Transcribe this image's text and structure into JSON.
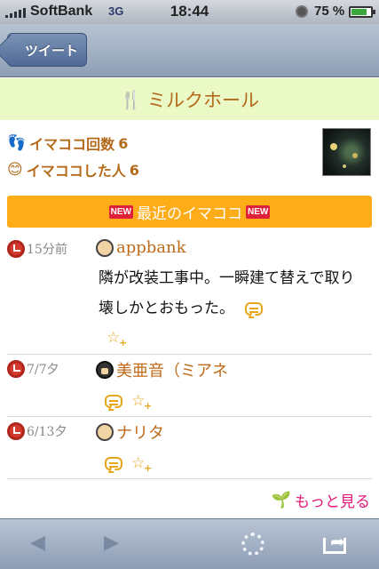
{
  "status": {
    "carrier": "SoftBank",
    "network": "3G",
    "time": "18:44",
    "battery_pct": "75 %",
    "battery_level": 0.75
  },
  "nav": {
    "back_label": "ツイート"
  },
  "title": {
    "text": "ミルクホール"
  },
  "stats": {
    "checkins_label": "イマココ回数",
    "checkins_value": "6",
    "people_label": "イマココした人",
    "people_value": "6"
  },
  "section": {
    "badge": "NEW",
    "label": "最近のイマココ"
  },
  "feed": [
    {
      "when": "15分前",
      "user": "appbank",
      "body": "隣が改装工事中。一瞬建て替えで取り壊しかとおもった。"
    },
    {
      "when": "7/7夕",
      "user": "美亜音（ミアネ",
      "body": ""
    },
    {
      "when": "6/13夕",
      "user": "ナリタ",
      "body": ""
    }
  ],
  "more": {
    "label": "もっと見る"
  },
  "icons": {
    "back": "back-arrow-icon",
    "forward": "forward-arrow-icon",
    "share": "share-icon"
  }
}
